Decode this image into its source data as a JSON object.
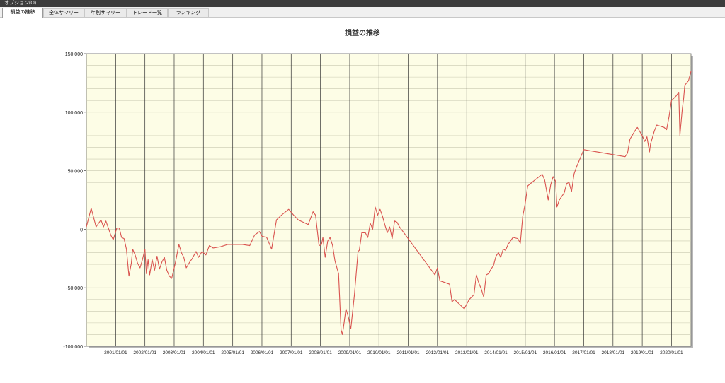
{
  "menu": {
    "options_label": "オプション(O)"
  },
  "tabs": [
    {
      "label": "損益の推移",
      "active": true
    },
    {
      "label": "全体サマリー",
      "active": false
    },
    {
      "label": "年別サマリー",
      "active": false
    },
    {
      "label": "トレード一覧",
      "active": false
    },
    {
      "label": "ランキング",
      "active": false
    }
  ],
  "colors": {
    "plot_background": "#fdfde6",
    "line": "#d9534f",
    "grid": "#c8c8b0",
    "vertical_grid": "#333333"
  },
  "chart_data": {
    "type": "line",
    "title": "損益の推移",
    "xlabel": "",
    "ylabel": "",
    "ylim": [
      -100000,
      150000
    ],
    "xlim": [
      "2000-01-01",
      "2020-09-01"
    ],
    "y_tick_labels": [
      "150,000",
      "100,000",
      "50,000",
      "0",
      "-50,000",
      "-100,000"
    ],
    "y_ticks": [
      150000,
      100000,
      50000,
      0,
      -50000,
      -100000
    ],
    "x_tick_labels": [
      "2001/01/01",
      "2002/01/01",
      "2003/01/01",
      "2004/01/01",
      "2005/01/01",
      "2006/01/01",
      "2007/01/01",
      "2008/01/01",
      "2009/01/01",
      "2010/01/01",
      "2011/01/01",
      "2012/01/01",
      "2013/01/01",
      "2014/01/01",
      "2015/01/01",
      "2016/01/01",
      "2017/01/01",
      "2018/01/01",
      "2019/01/01",
      "2020/01/01"
    ],
    "grid": true,
    "legend": false,
    "series": [
      {
        "points": [
          [
            "2000-01-01",
            2000
          ],
          [
            "2000-03-01",
            18000
          ],
          [
            "2000-05-01",
            2000
          ],
          [
            "2000-07-01",
            8000
          ],
          [
            "2000-08-01",
            2000
          ],
          [
            "2000-09-01",
            7000
          ],
          [
            "2000-11-01",
            -5000
          ],
          [
            "2000-12-01",
            -9000
          ],
          [
            "2001-01-15",
            1000
          ],
          [
            "2001-02-15",
            1000
          ],
          [
            "2001-03-15",
            -7000
          ],
          [
            "2001-04-15",
            -8000
          ],
          [
            "2001-05-15",
            -17000
          ],
          [
            "2001-06-15",
            -40000
          ],
          [
            "2001-07-15",
            -29000
          ],
          [
            "2001-08-01",
            -17000
          ],
          [
            "2001-09-01",
            -22000
          ],
          [
            "2001-10-01",
            -29000
          ],
          [
            "2001-11-01",
            -33000
          ],
          [
            "2001-12-01",
            -26000
          ],
          [
            "2002-01-01",
            -17000
          ],
          [
            "2002-01-20",
            -38000
          ],
          [
            "2002-02-10",
            -26000
          ],
          [
            "2002-03-01",
            -39000
          ],
          [
            "2002-04-01",
            -26000
          ],
          [
            "2002-05-01",
            -35000
          ],
          [
            "2002-06-01",
            -23000
          ],
          [
            "2002-07-01",
            -34000
          ],
          [
            "2002-08-01",
            -28000
          ],
          [
            "2002-09-01",
            -24000
          ],
          [
            "2002-10-01",
            -35000
          ],
          [
            "2002-11-01",
            -40000
          ],
          [
            "2002-12-01",
            -42000
          ],
          [
            "2003-01-15",
            -29000
          ],
          [
            "2003-03-01",
            -13000
          ],
          [
            "2003-04-01",
            -20000
          ],
          [
            "2003-05-01",
            -24000
          ],
          [
            "2003-06-01",
            -33000
          ],
          [
            "2003-07-15",
            -28000
          ],
          [
            "2003-08-15",
            -25000
          ],
          [
            "2003-10-01",
            -19000
          ],
          [
            "2003-11-01",
            -24000
          ],
          [
            "2003-12-15",
            -19000
          ],
          [
            "2004-02-01",
            -22000
          ],
          [
            "2004-03-15",
            -14000
          ],
          [
            "2004-05-01",
            -16000
          ],
          [
            "2004-08-01",
            -15000
          ],
          [
            "2004-11-01",
            -13000
          ],
          [
            "2005-05-01",
            -13000
          ],
          [
            "2005-08-01",
            -14000
          ],
          [
            "2005-10-01",
            -5000
          ],
          [
            "2005-12-01",
            -2000
          ],
          [
            "2006-01-01",
            -6000
          ],
          [
            "2006-03-01",
            -7000
          ],
          [
            "2006-05-01",
            -17000
          ],
          [
            "2006-07-01",
            8000
          ],
          [
            "2006-09-01",
            12000
          ],
          [
            "2006-12-01",
            17000
          ],
          [
            "2007-02-01",
            12000
          ],
          [
            "2007-04-01",
            8000
          ],
          [
            "2007-08-01",
            4000
          ],
          [
            "2007-10-01",
            15000
          ],
          [
            "2007-11-01",
            12000
          ],
          [
            "2007-12-15",
            -14000
          ],
          [
            "2008-01-15",
            -13000
          ],
          [
            "2008-02-01",
            -7000
          ],
          [
            "2008-03-01",
            -24000
          ],
          [
            "2008-04-01",
            -10000
          ],
          [
            "2008-05-01",
            -7000
          ],
          [
            "2008-06-01",
            -14000
          ],
          [
            "2008-07-01",
            -27000
          ],
          [
            "2008-08-15",
            -38000
          ],
          [
            "2008-09-15",
            -86000
          ],
          [
            "2008-10-01",
            -90000
          ],
          [
            "2008-10-15",
            -84000
          ],
          [
            "2008-11-15",
            -68000
          ],
          [
            "2008-12-15",
            -75000
          ],
          [
            "2009-01-15",
            -85000
          ],
          [
            "2009-03-01",
            -56000
          ],
          [
            "2009-04-15",
            -19000
          ],
          [
            "2009-05-01",
            -18000
          ],
          [
            "2009-06-01",
            -3000
          ],
          [
            "2009-07-15",
            -3000
          ],
          [
            "2009-08-15",
            -7000
          ],
          [
            "2009-09-15",
            5000
          ],
          [
            "2009-10-15",
            0
          ],
          [
            "2009-11-15",
            19000
          ],
          [
            "2009-12-15",
            12000
          ],
          [
            "2010-01-15",
            17000
          ],
          [
            "2010-02-15",
            11000
          ],
          [
            "2010-03-15",
            4000
          ],
          [
            "2010-04-15",
            -3000
          ],
          [
            "2010-05-15",
            2000
          ],
          [
            "2010-06-15",
            -8000
          ],
          [
            "2010-07-15",
            7000
          ],
          [
            "2010-08-15",
            6000
          ],
          [
            "2010-09-15",
            2000
          ],
          [
            "2011-12-01",
            -39000
          ],
          [
            "2012-01-01",
            -33000
          ],
          [
            "2012-02-01",
            -44000
          ],
          [
            "2012-06-01",
            -47000
          ],
          [
            "2012-07-01",
            -62000
          ],
          [
            "2012-08-01",
            -60000
          ],
          [
            "2012-12-01",
            -68000
          ],
          [
            "2013-02-01",
            -60000
          ],
          [
            "2013-04-01",
            -56000
          ],
          [
            "2013-05-01",
            -39000
          ],
          [
            "2013-06-01",
            -46000
          ],
          [
            "2013-07-01",
            -51000
          ],
          [
            "2013-08-01",
            -58000
          ],
          [
            "2013-09-01",
            -39000
          ],
          [
            "2013-10-01",
            -38000
          ],
          [
            "2013-11-01",
            -34000
          ],
          [
            "2013-12-01",
            -31000
          ],
          [
            "2014-01-01",
            -23000
          ],
          [
            "2014-02-01",
            -20000
          ],
          [
            "2014-03-01",
            -24000
          ],
          [
            "2014-04-01",
            -17000
          ],
          [
            "2014-05-01",
            -18000
          ],
          [
            "2014-06-01",
            -13000
          ],
          [
            "2014-08-01",
            -7000
          ],
          [
            "2014-10-01",
            -8000
          ],
          [
            "2014-11-01",
            -12000
          ],
          [
            "2014-12-01",
            11000
          ],
          [
            "2015-01-01",
            22000
          ],
          [
            "2015-02-01",
            37000
          ],
          [
            "2015-05-01",
            42000
          ],
          [
            "2015-08-01",
            47000
          ],
          [
            "2015-09-01",
            42000
          ],
          [
            "2015-10-15",
            25000
          ],
          [
            "2015-11-15",
            38000
          ],
          [
            "2015-12-15",
            45000
          ],
          [
            "2016-01-15",
            41000
          ],
          [
            "2016-02-01",
            19000
          ],
          [
            "2016-03-01",
            25000
          ],
          [
            "2016-05-01",
            31000
          ],
          [
            "2016-06-01",
            39000
          ],
          [
            "2016-07-01",
            40000
          ],
          [
            "2016-08-01",
            32000
          ],
          [
            "2016-09-01",
            47000
          ],
          [
            "2016-10-01",
            53000
          ],
          [
            "2017-01-01",
            68000
          ],
          [
            "2018-06-01",
            62000
          ],
          [
            "2018-07-01",
            65000
          ],
          [
            "2018-08-01",
            77000
          ],
          [
            "2018-10-01",
            84000
          ],
          [
            "2018-11-01",
            87000
          ],
          [
            "2019-01-01",
            80000
          ],
          [
            "2019-02-01",
            75000
          ],
          [
            "2019-03-01",
            79000
          ],
          [
            "2019-04-01",
            66000
          ],
          [
            "2019-04-15",
            73000
          ],
          [
            "2019-06-01",
            84000
          ],
          [
            "2019-07-01",
            89000
          ],
          [
            "2019-10-01",
            87000
          ],
          [
            "2019-11-01",
            85000
          ],
          [
            "2019-12-01",
            96000
          ],
          [
            "2020-01-01",
            110000
          ],
          [
            "2020-03-01",
            114000
          ],
          [
            "2020-04-01",
            117000
          ],
          [
            "2020-04-15",
            80000
          ],
          [
            "2020-05-15",
            103000
          ],
          [
            "2020-06-01",
            112000
          ],
          [
            "2020-06-15",
            123000
          ],
          [
            "2020-08-01",
            127000
          ],
          [
            "2020-09-01",
            135000
          ]
        ]
      }
    ]
  }
}
